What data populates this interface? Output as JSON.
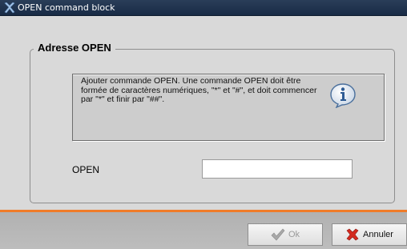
{
  "window": {
    "title": "OPEN command block"
  },
  "group": {
    "legend": "Adresse OPEN"
  },
  "info": {
    "text": "Ajouter commande OPEN. Une commande OPEN doit être formée de caractères numériques, \"*\" et \"#\", et doit commencer par \"*\" et finir par \"##\".",
    "icon": "info-icon"
  },
  "form": {
    "open_label": "OPEN",
    "open_value": ""
  },
  "buttons": {
    "ok_label": "Ok",
    "ok_enabled": false,
    "cancel_label": "Annuler"
  },
  "colors": {
    "titlebar": "#1e3350",
    "accent": "#f07c29",
    "panel": "#d9d9d9"
  }
}
